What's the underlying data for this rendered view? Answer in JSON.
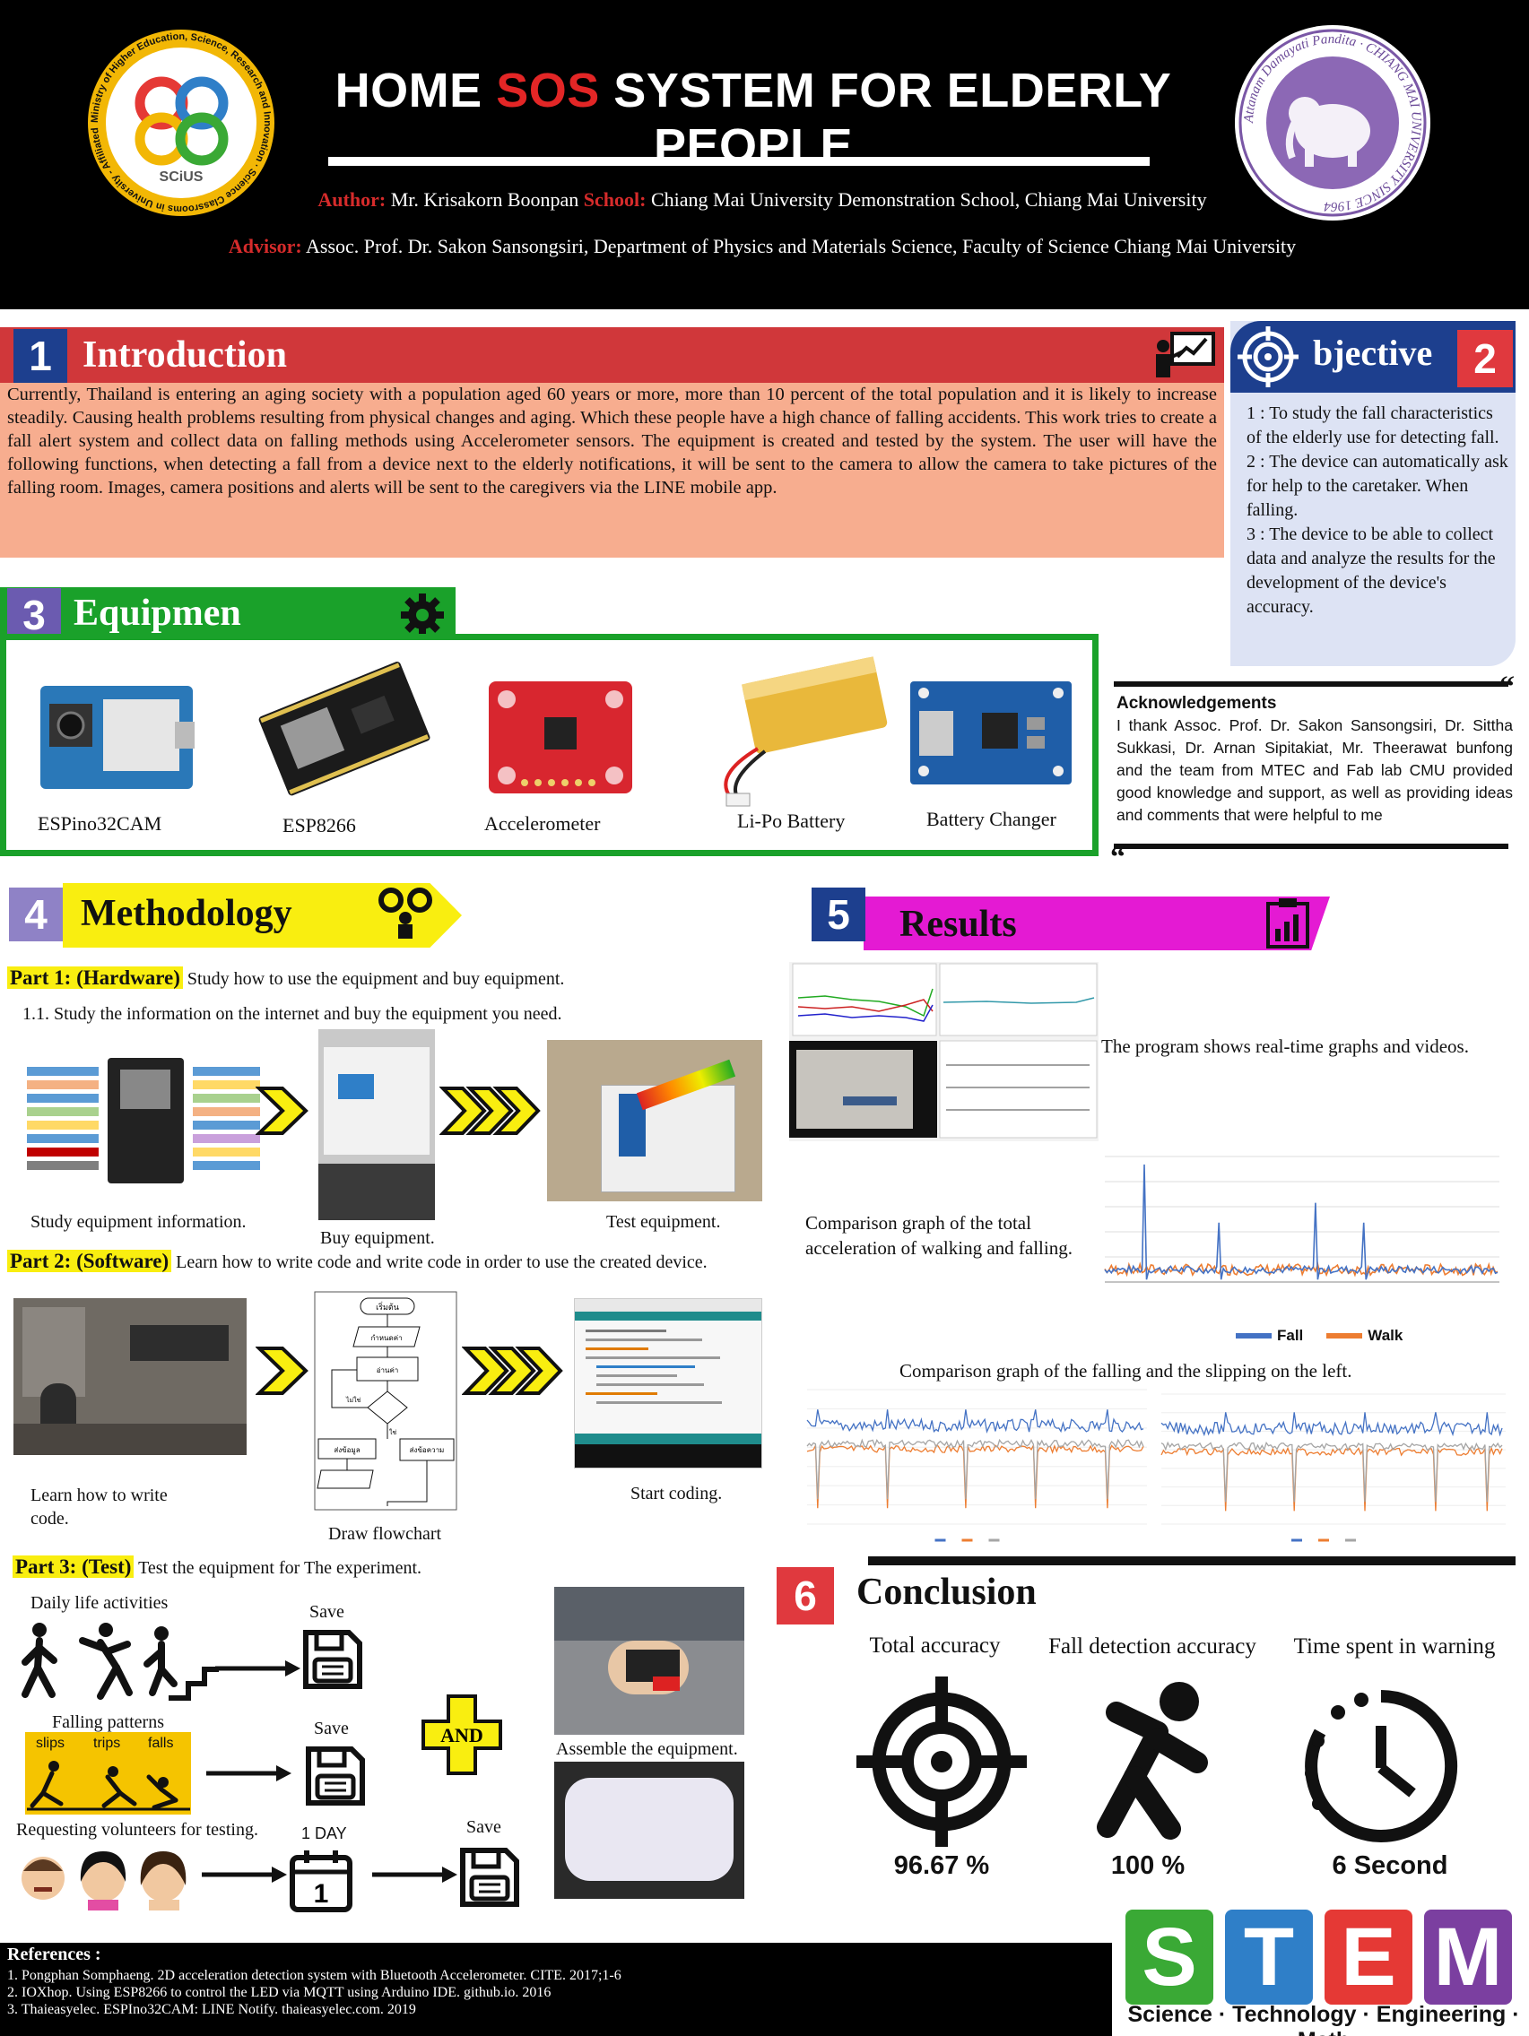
{
  "header": {
    "title_pre": "HOME ",
    "title_sos": "SOS",
    "title_post": " SYSTEM FOR ELDERLY PEOPLE",
    "author_label": "Author:",
    "author_name": " Mr. Krisakorn Boonpan ",
    "school_label": "School:",
    "school_name": " Chiang Mai University Demonstration School, Chiang Mai University",
    "advisor_label": "Advisor:",
    "advisor_text": " Assoc. Prof. Dr. Sakon Sansongsiri, Department of Physics and Materials Science, Faculty of Science Chiang Mai University",
    "logo_left_text": "SCiUS",
    "logo_left_ring": "Ministry of Higher Education, Science, Research and Innovation · Science Classrooms in University - Affiliated School Project",
    "logo_right_ring": "Attanam Damayati Pandita · CHIANG MAI UNIVERSITY SINCE 1964"
  },
  "introduction": {
    "number": "1",
    "title": "Introduction",
    "text": "Currently, Thailand is entering an aging society with a population aged 60 years or more, more than 10 percent of the total population and it is likely to increase steadily. Causing health problems resulting from physical changes and aging. Which these people have a high chance of falling accidents. This work tries to create a fall alert system and collect data on falling methods using Accelerometer sensors. The equipment is created and tested by the system. The user will have the following functions, when detecting a fall from a device next to the elderly notifications, it will be sent to the camera to allow the camera to take pictures of the falling room. Images, camera positions and alerts will be sent to the caregivers via the LINE mobile app."
  },
  "objective": {
    "number": "2",
    "title": "bjective",
    "items": [
      "1 : To study the fall characteristics of the elderly use for detecting fall.",
      "2 : The device can automatically ask for help to the caretaker. When falling.",
      "3 : The device to be able to collect data and analyze the results for the development of the device's accuracy."
    ]
  },
  "equipment": {
    "number": "3",
    "title": "Equipmen",
    "items": [
      "ESPino32CAM",
      "ESP8266",
      "Accelerometer",
      "Li-Po Battery",
      "Battery Changer"
    ]
  },
  "acknowledgements": {
    "title": "Acknowledgements",
    "text": "I thank Assoc. Prof. Dr. Sakon Sansongsiri, Dr. Sittha Sukkasi, Dr. Arnan Sipitakiat, Mr. Theerawat bunfong and the team from MTEC and Fab lab CMU provided good knowledge and support, as well as providing ideas and comments that were helpful to me"
  },
  "methodology": {
    "number": "4",
    "title": "Methodology",
    "part1_tag": "Part 1: (Hardware)",
    "part1_text": " Study how to use the equipment and buy equipment.",
    "part1_sub": "1.1. Study the information on the internet and buy the equipment you need.",
    "part1_caps": [
      "Study equipment information.",
      "Buy equipment.",
      "Test equipment."
    ],
    "part2_tag": "Part 2: (Software)",
    "part2_text": " Learn how to write code and write code in order to use the created device.",
    "part2_caps": [
      "Learn how to write code.",
      "Draw flowchart",
      "Start coding."
    ],
    "flow_labels": [
      "เริ่มต้น",
      "กำหนดค่า",
      "อ่านค่า",
      "ไม่ใช่",
      "ใช่",
      "ส่งข้อมูล",
      "ส่งข้อความ"
    ],
    "part3_tag": "Part 3: (Test)",
    "part3_text": " Test the equipment for The experiment.",
    "daily": "Daily life activities",
    "falling_patterns": "Falling patterns",
    "patterns": [
      "slips",
      "trips",
      "falls"
    ],
    "volunteers": "Requesting volunteers for testing.",
    "save": "Save",
    "one_day": "1 DAY",
    "calendar_day": "1",
    "and": "AND",
    "assemble": "Assemble the equipment."
  },
  "results": {
    "number": "5",
    "title": "Results",
    "program_caption": "The program shows real-time graphs and videos.",
    "total_caption": "Comparison graph of the total acceleration of walking and falling.",
    "slip_caption": "Comparison graph of the falling and the slipping on the left.",
    "legend_fall": "Fall",
    "legend_walk": "Walk",
    "color_fall": "#4472c4",
    "color_walk": "#ed7d31"
  },
  "conclusion": {
    "number": "6",
    "title": "Conclusion",
    "metrics": [
      {
        "label": "Total accuracy",
        "value": "96.67 %",
        "icon": "target-icon"
      },
      {
        "label": "Fall detection accuracy",
        "value": "100 %",
        "icon": "falling-person-icon"
      },
      {
        "label": "Time spent in warning",
        "value": "6 Second",
        "icon": "timer-icon"
      }
    ]
  },
  "references": {
    "title": "References :",
    "items": [
      "1. Pongphan Somphaeng. 2D acceleration detection system with Bluetooth Accelerometer. CITE. 2017;1-6",
      "2. IOXhop. Using ESP8266 to control the LED via MQTT using Arduino IDE. github.io. 2016",
      "3. Thaieasyelec. ESPIno32CAM: LINE Notify. thaieasyelec.com. 2019"
    ]
  },
  "stem": {
    "letters": [
      "S",
      "T",
      "E",
      "M"
    ],
    "colors": [
      "#3aa935",
      "#2f7fc8",
      "#e53935",
      "#7b3fa0"
    ],
    "subtitle": "Science · Technology · Engineering · Math"
  }
}
